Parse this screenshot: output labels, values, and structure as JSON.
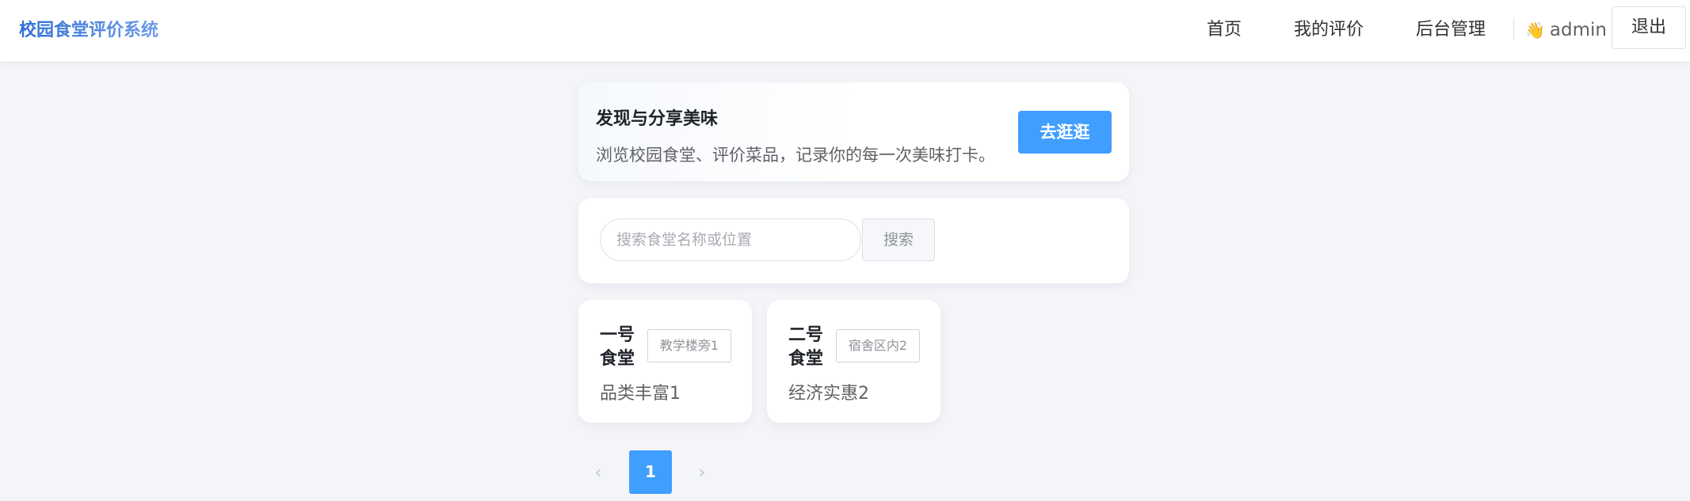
{
  "header": {
    "brand": "校园食堂评价系统",
    "nav": [
      "首页",
      "我的评价",
      "后台管理"
    ],
    "user_icon": "waving-hand-icon",
    "username": "admin",
    "logout_label": "退出"
  },
  "hero": {
    "title": "发现与分享美味",
    "description": "浏览校园食堂、评价菜品，记录你的每一次美味打卡。",
    "button_label": "去逛逛"
  },
  "search": {
    "placeholder": "搜索食堂名称或位置",
    "button_label": "搜索"
  },
  "canteens": [
    {
      "name": "一号食堂",
      "location": "教学楼旁1",
      "description": "品类丰富1"
    },
    {
      "name": "二号食堂",
      "location": "宿舍区内2",
      "description": "经济实惠2"
    }
  ],
  "pagination": {
    "prev_icon": "chevron-left-icon",
    "current_page": "1",
    "next_icon": "chevron-right-icon"
  },
  "colors": {
    "primary": "#409eff",
    "background": "#f4f5f9",
    "brand_gradient_start": "#2f6fd6",
    "brand_gradient_end": "#6d9bea"
  }
}
